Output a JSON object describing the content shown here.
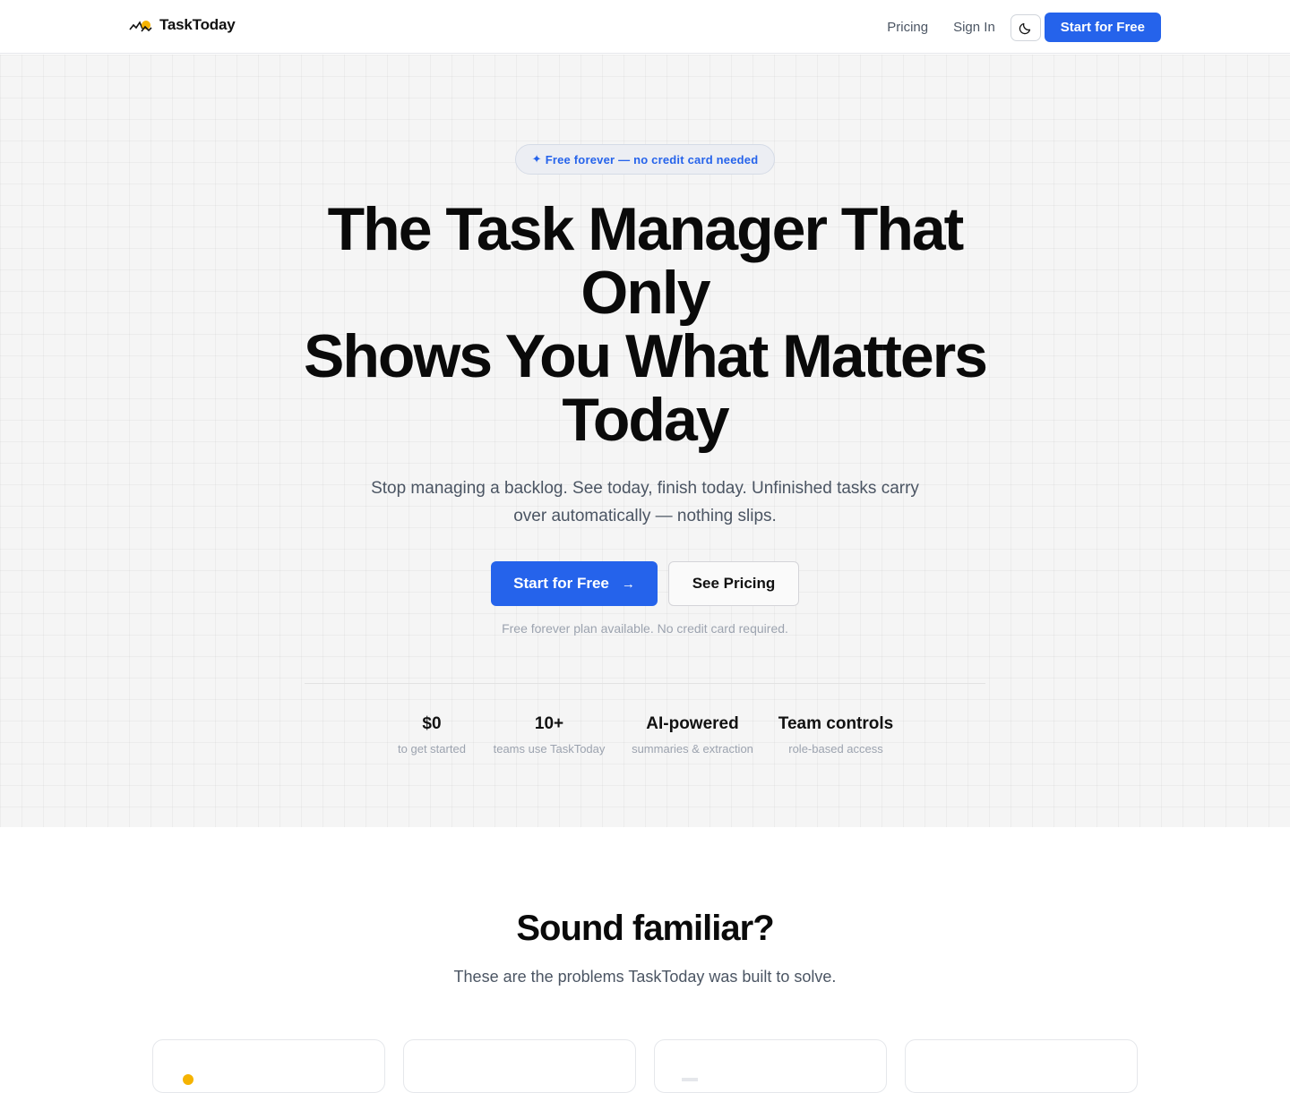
{
  "header": {
    "brand": "TaskToday",
    "nav": {
      "pricing": "Pricing",
      "sign_in": "Sign In",
      "cta": "Start for Free"
    },
    "theme_toggle_icon": "moon-icon"
  },
  "hero": {
    "badge_icon": "sparkle-icon",
    "badge": "Free forever — no credit card needed",
    "headline_lines": [
      "The Task Manager That",
      "Only",
      "Shows You What Matters",
      "Today"
    ],
    "subtitle": "Stop managing a backlog. See today, finish today. Unfinished tasks carry over automatically — nothing slips.",
    "primary_cta": "Start for Free",
    "secondary_cta": "See Pricing",
    "note": "Free forever plan available. No credit card required.",
    "stats": [
      {
        "value": "$0",
        "label": "to get started"
      },
      {
        "value": "10+",
        "label": "teams use TaskToday"
      },
      {
        "value": "AI-powered",
        "label": "summaries & extraction"
      },
      {
        "value": "Team controls",
        "label": "role-based access"
      }
    ]
  },
  "problems": {
    "title": "Sound familiar?",
    "subtitle": "These are the problems TaskToday was built to solve."
  },
  "colors": {
    "accent": "#2563eb",
    "hero_bg": "#f5f5f5",
    "text": "#0a0a0a",
    "muted": "#9ca3af"
  }
}
